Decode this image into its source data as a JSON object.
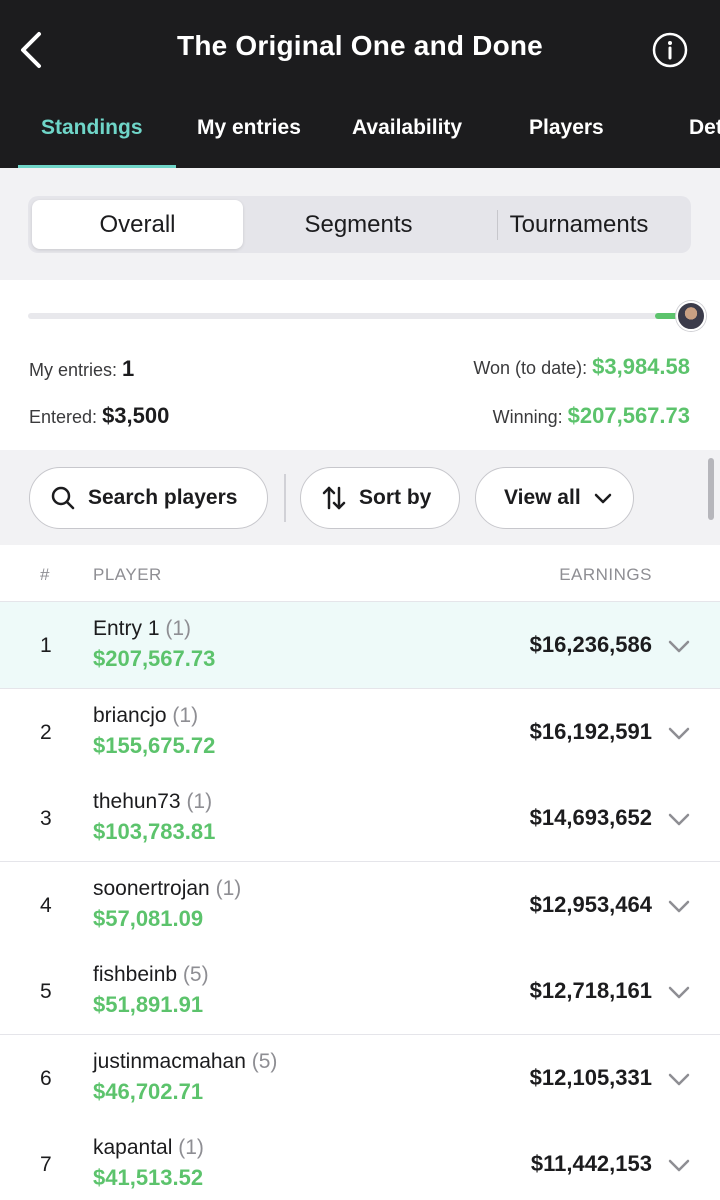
{
  "header": {
    "title": "The Original One and Done",
    "tabs": [
      {
        "label": "Standings",
        "active": true
      },
      {
        "label": "My entries",
        "active": false
      },
      {
        "label": "Availability",
        "active": false
      },
      {
        "label": "Players",
        "active": false
      },
      {
        "label": "Det",
        "active": false
      }
    ],
    "icons": {
      "back": "chevron-left-icon",
      "info": "info-circle-icon"
    }
  },
  "segments": {
    "options": [
      "Overall",
      "Segments",
      "Tournaments"
    ],
    "selected": "Overall"
  },
  "summary": {
    "progress_fraction": 0.05,
    "my_entries_label": "My entries:",
    "my_entries_value": "1",
    "won_label": "Won (to date):",
    "won_value": "$3,984.58",
    "entered_label": "Entered:",
    "entered_value": "$3,500",
    "winning_label": "Winning:",
    "winning_value": "$207,567.73"
  },
  "filters": {
    "search_label": "Search players",
    "sort_label": "Sort by",
    "view_label": "View all"
  },
  "table": {
    "columns": {
      "rank": "#",
      "player": "PLAYER",
      "earnings": "EARNINGS"
    },
    "rows": [
      {
        "rank": "1",
        "name": "Entry 1",
        "count": "(1)",
        "winning": "$207,567.73",
        "earnings": "$16,236,586",
        "mine": true
      },
      {
        "rank": "2",
        "name": "briancjo",
        "count": "(1)",
        "winning": "$155,675.72",
        "earnings": "$16,192,591",
        "mine": false
      },
      {
        "rank": "3",
        "name": "thehun73",
        "count": "(1)",
        "winning": "$103,783.81",
        "earnings": "$14,693,652",
        "mine": false
      },
      {
        "rank": "4",
        "name": "soonertrojan",
        "count": "(1)",
        "winning": "$57,081.09",
        "earnings": "$12,953,464",
        "mine": false
      },
      {
        "rank": "5",
        "name": "fishbeinb",
        "count": "(5)",
        "winning": "$51,891.91",
        "earnings": "$12,718,161",
        "mine": false
      },
      {
        "rank": "6",
        "name": "justinmacmahan",
        "count": "(5)",
        "winning": "$46,702.71",
        "earnings": "$12,105,331",
        "mine": false
      },
      {
        "rank": "7",
        "name": "kapantal",
        "count": "(1)",
        "winning": "$41,513.52",
        "earnings": "$11,442,153",
        "mine": false
      }
    ]
  },
  "colors": {
    "header_bg": "#1c1c1e",
    "accent_teal": "#6fd5c8",
    "money_green": "#5cc36c",
    "highlight_row": "#eefaf9"
  }
}
